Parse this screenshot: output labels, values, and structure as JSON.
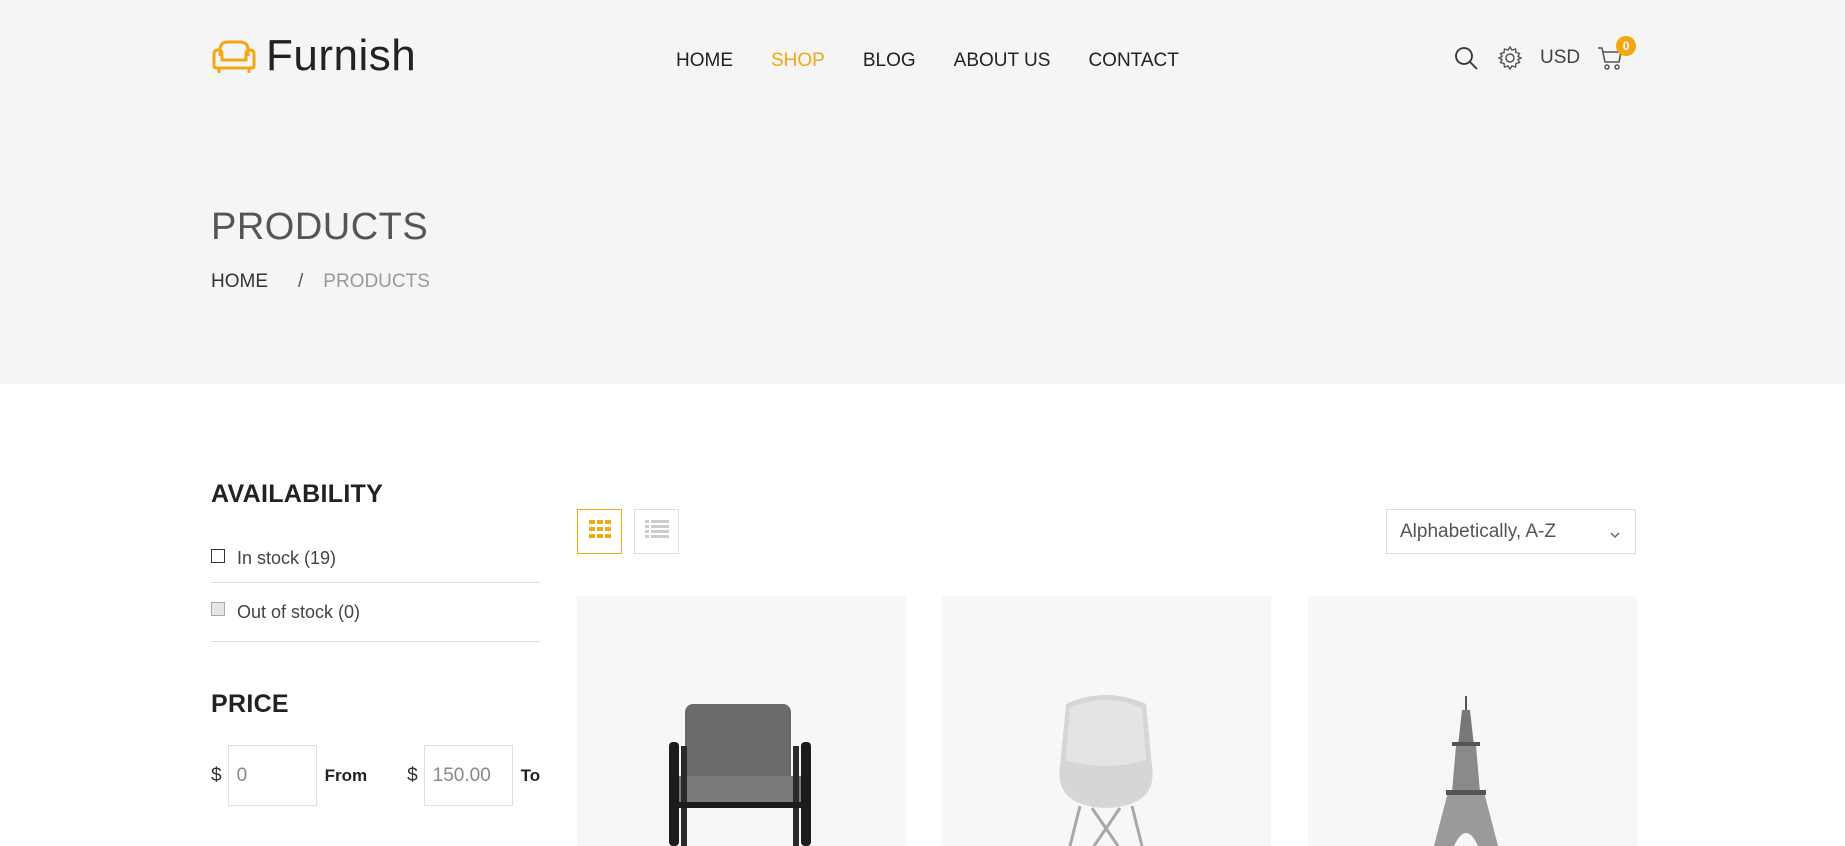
{
  "brand": {
    "name": "Furnish",
    "accent_color": "#f3a712"
  },
  "nav": {
    "items": [
      {
        "label": "HOME",
        "active": false
      },
      {
        "label": "SHOP",
        "active": true
      },
      {
        "label": "BLOG",
        "active": false
      },
      {
        "label": "ABOUT US",
        "active": false
      },
      {
        "label": "CONTACT",
        "active": false
      }
    ]
  },
  "header_tools": {
    "search_icon": "search-icon",
    "settings_icon": "gear-icon",
    "currency": "USD",
    "cart_icon": "cart-icon",
    "cart_count": "0"
  },
  "page": {
    "title": "PRODUCTS",
    "breadcrumb": {
      "home": "HOME",
      "separator": "/",
      "current": "PRODUCTS"
    }
  },
  "filters": {
    "availability": {
      "title": "AVAILABILITY",
      "options": [
        {
          "label": "In stock (19)"
        },
        {
          "label": "Out of stock (0)"
        }
      ]
    },
    "price": {
      "title": "PRICE",
      "currency_symbol": "$",
      "from_value": "0",
      "from_label": "From",
      "to_value": "150.00",
      "to_label": "To"
    }
  },
  "toolbar": {
    "grid_view_icon": "grid-icon",
    "list_view_icon": "list-icon",
    "sort_selected": "Alphabetically, A-Z"
  },
  "products": [
    {
      "image": "armchair-grey"
    },
    {
      "image": "white-eames-chair"
    },
    {
      "image": "eiffel-tower-model"
    }
  ]
}
